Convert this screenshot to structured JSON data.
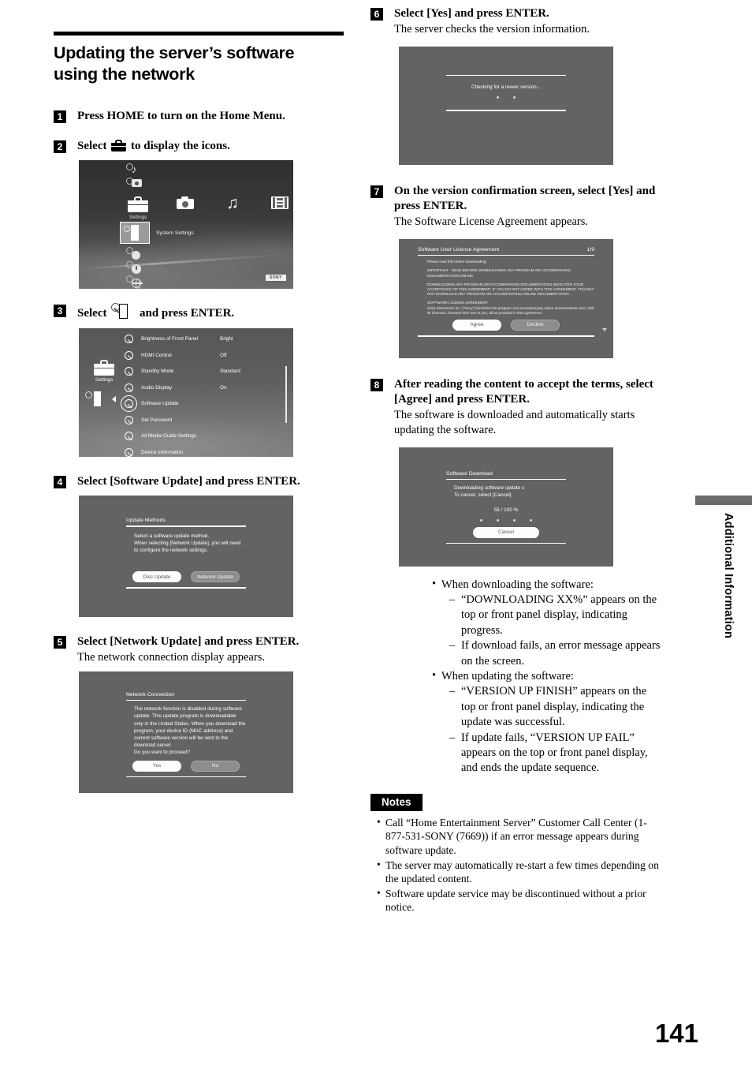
{
  "page": {
    "number": "141",
    "side_tab": "Additional Information",
    "chapter_title": "Updating the server’s software using the network"
  },
  "steps": [
    {
      "num": "1",
      "title_before": "Press HOME to turn on the Home Menu.",
      "title_after": "",
      "desc": ""
    },
    {
      "num": "2",
      "title_before": "Select",
      "title_after": "to display the icons.",
      "icon": "toolbox-icon",
      "desc": ""
    },
    {
      "num": "3",
      "title_before": "Select",
      "title_after": "and press ENTER.",
      "icon": "system-settings-icon",
      "desc": ""
    },
    {
      "num": "4",
      "title_before": "Select [Software Update] and press ENTER.",
      "title_after": "",
      "desc": ""
    },
    {
      "num": "5",
      "title_before": "Select [Network Update] and press ENTER.",
      "title_after": "",
      "desc": "The network connection display appears."
    },
    {
      "num": "6",
      "title_before": "Select [Yes] and press ENTER.",
      "title_after": "",
      "desc": "The server checks the version information."
    },
    {
      "num": "7",
      "title_before": "On the version confirmation screen, select [Yes] and press ENTER.",
      "title_after": "",
      "desc": "The Software License Agreement appears."
    },
    {
      "num": "8",
      "title_before": "After reading the content to accept the terms, select [Agree] and press ENTER.",
      "title_after": "",
      "desc": "The software is downloaded and automatically starts updating the software."
    }
  ],
  "xmb_screen": {
    "categories": [
      {
        "label": "Settings",
        "icon": "toolbox-icon"
      },
      {
        "label": "",
        "icon": "camera-icon"
      },
      {
        "label": "",
        "icon": "music-note-icon"
      },
      {
        "label": "",
        "icon": "film-icon"
      },
      {
        "label": "",
        "icon": "input-icon"
      }
    ],
    "selected_item": "System Settings",
    "brand_badge": "SONY"
  },
  "settings_screen": {
    "column_label": "Settings",
    "rows": [
      {
        "name": "Brightness of Front Panel",
        "value": "Bright"
      },
      {
        "name": "HDMI Control",
        "value": "Off"
      },
      {
        "name": "Standby Mode",
        "value": "Standard"
      },
      {
        "name": "Audio Display",
        "value": "On"
      },
      {
        "name": "Software Update",
        "value": ""
      },
      {
        "name": "Set Password",
        "value": ""
      },
      {
        "name": "All Media Guide Settings",
        "value": ""
      },
      {
        "name": "Device Information",
        "value": ""
      },
      {
        "name": "",
        "value": ""
      }
    ],
    "selected_row": "Software Update"
  },
  "update_methods_screen": {
    "title": "Update Methods",
    "body": "Select a software update method.\nWhen selecting [Network Update], you will need to configure the network settings.",
    "buttons": [
      {
        "label": "Disc Update",
        "style": "light"
      },
      {
        "label": "Network Update",
        "style": "dark"
      }
    ]
  },
  "network_connection_screen": {
    "title": "Network Connection",
    "body": "The network function is disabled during software update. This update program is downloadable only in the United States. When you download the program, your device ID (MAC address) and current software version will be sent to the download server.\nDo you want to proceed?",
    "buttons": [
      {
        "label": "Yes",
        "style": "light"
      },
      {
        "label": "No",
        "style": "dark"
      }
    ]
  },
  "checking_screen": {
    "message": "Checking for a newer version..."
  },
  "license_screen": {
    "title": "Software User License Agreement",
    "page_indicator": "1/9",
    "intro": "Please read this before downloading:",
    "paragraphs": [
      "IMPORTANT - READ BEFORE DOWNLOADING ANY PROGRAM OR ACCOMPANYING DOCUMENTATION ONLINE",
      "DOWNLOADING ANY PROGRAM OR ACCOMPANYING DOCUMENTATION INDICATES YOUR ACCEPTANCE OF THIS AGREEMENT. IF YOU DO NOT AGREE WITH THIS AGREEMENT, YOU MAY NOT DOWNLOAD ANY PROGRAM OR ACCOMPANYING ONLINE DOCUMENTATION.",
      "SOFTWARE LICENSE AGREEMENT",
      "Sony Electronics Inc, (\"Sony\") furnishes the program and accompanying online documentation and, with its licensors, licenses their use to you, all as provided in this Agreement."
    ],
    "buttons": [
      {
        "label": "Agree",
        "style": "light"
      },
      {
        "label": "Decline",
        "style": "dark"
      }
    ]
  },
  "download_screen": {
    "title": "Software Download",
    "body": "Downloading software update c\nTo cancel, select [Cancel].",
    "progress": "55 / 100 %",
    "buttons": [
      {
        "label": "Cancel",
        "style": "light"
      }
    ]
  },
  "info_bullets": [
    {
      "text": "When downloading the software:",
      "sub": [
        "“DOWNLOADING XX%” appears on the top or front panel display, indicating progress.",
        "If download fails, an error message appears on the screen."
      ]
    },
    {
      "text": "When updating the software:",
      "sub": [
        "“VERSION UP FINISH” appears on the top or front panel display, indicating the update was successful.",
        "If update fails, “VERSION UP FAIL” appears on the top or front panel display, and ends the update sequence."
      ]
    }
  ],
  "notes": {
    "label": "Notes",
    "items": [
      "Call “Home Entertainment Server” Customer Call Center (1-877-531-SONY (7669)) if an error message appears during software update.",
      "The server may automatically re-start a few times depending on the updated content.",
      "Software update service may be discontinued without a prior notice."
    ]
  }
}
